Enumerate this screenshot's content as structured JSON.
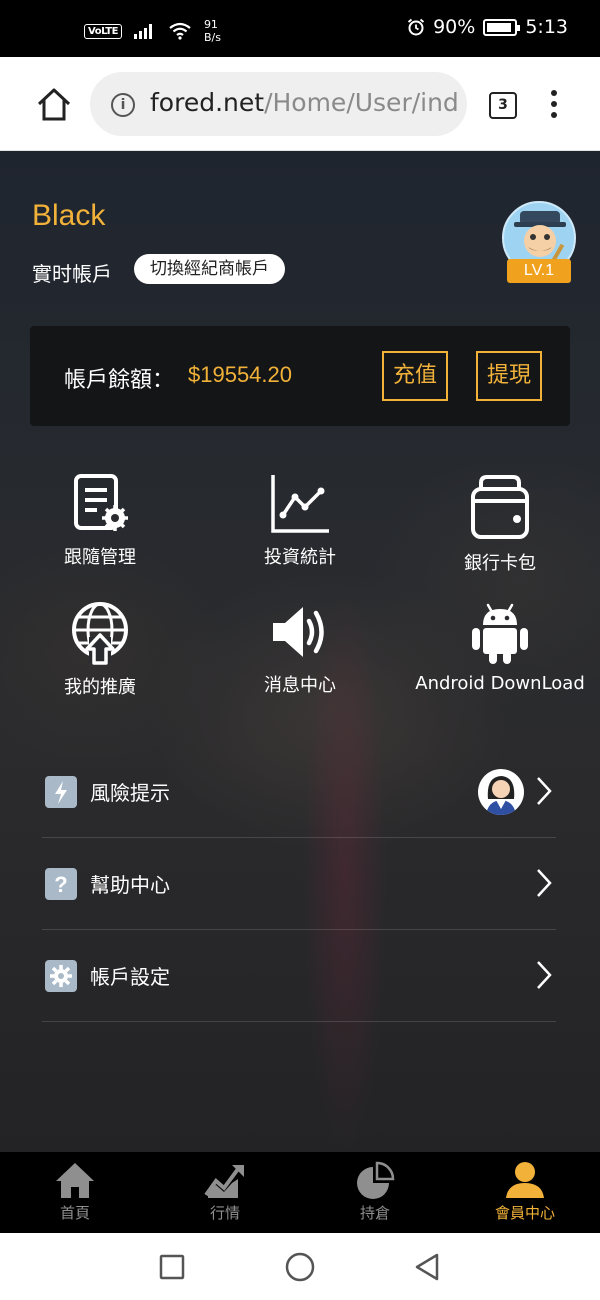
{
  "status_bar": {
    "volte": "VoLTE",
    "net_speed_value": "91",
    "net_speed_unit": "B/s",
    "battery": "90%",
    "time": "5:13"
  },
  "browser": {
    "url_domain": "fored.net",
    "url_path": "/Home/User/ind",
    "tab_count": "3"
  },
  "profile": {
    "name": "Black",
    "account_type": "實时帳戶",
    "switch_label": "切換經紀商帳戶",
    "level": "LV.1"
  },
  "balance": {
    "label": "帳戶餘額：",
    "value": "$19554.20",
    "deposit_label": "充值",
    "withdraw_label": "提現"
  },
  "grid": [
    {
      "label": "跟隨管理",
      "icon": "follow-management-icon"
    },
    {
      "label": "投資統計",
      "icon": "investment-statistics-icon"
    },
    {
      "label": "銀行卡包",
      "icon": "wallet-icon"
    },
    {
      "label": "我的推廣",
      "icon": "globe-share-icon"
    },
    {
      "label": "消息中心",
      "icon": "speaker-icon"
    },
    {
      "label": "Android DownLoad",
      "icon": "android-icon"
    }
  ],
  "menu": [
    {
      "label": "風險提示",
      "icon": "lightning-icon"
    },
    {
      "label": "幫助中心",
      "icon": "question-icon"
    },
    {
      "label": "帳戶設定",
      "icon": "gear-icon"
    }
  ],
  "tabbar": [
    {
      "label": "首頁",
      "icon": "home-icon"
    },
    {
      "label": "行情",
      "icon": "market-chart-icon"
    },
    {
      "label": "持倉",
      "icon": "pie-chart-icon"
    },
    {
      "label": "會員中心",
      "icon": "member-icon",
      "active": true
    }
  ],
  "colors": {
    "accent": "#f2b23a",
    "background": "#272a2f",
    "tab_inactive": "#8f8f8f"
  }
}
